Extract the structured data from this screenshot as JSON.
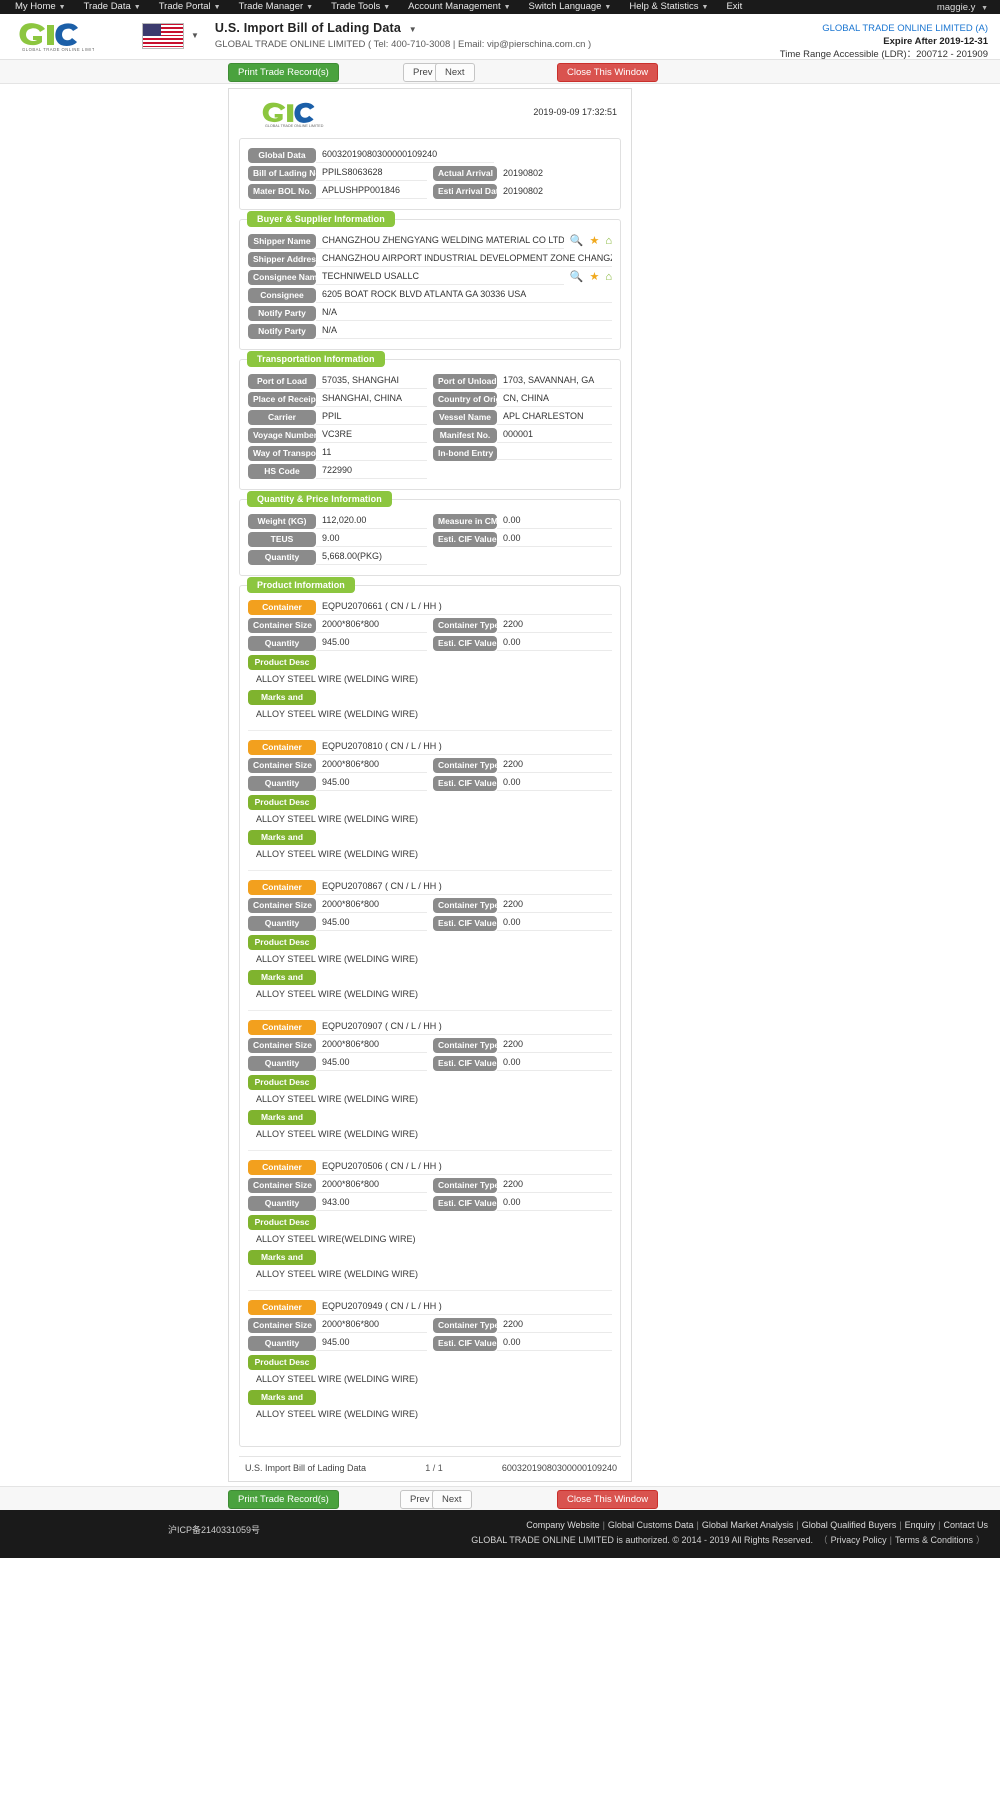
{
  "topnav": {
    "items": [
      {
        "label": "My Home",
        "caret": true
      },
      {
        "label": "Trade Data",
        "caret": true
      },
      {
        "label": "Trade Portal",
        "caret": true
      },
      {
        "label": "Trade Manager",
        "caret": true
      },
      {
        "label": "Trade Tools",
        "caret": true
      },
      {
        "label": "Account Management",
        "caret": true
      },
      {
        "label": "Switch Language",
        "caret": true
      },
      {
        "label": "Help & Statistics",
        "caret": true
      },
      {
        "label": "Exit",
        "caret": false
      }
    ],
    "user": "maggie.y"
  },
  "header": {
    "logo_text": "GLOBAL TRADE ONLINE LIMITED",
    "flag_icon": "us-flag-icon",
    "title": "U.S. Import Bill of Lading Data",
    "subtitle": "GLOBAL TRADE ONLINE LIMITED ( Tel: 400-710-3008 | Email: vip@pierschina.com.cn )",
    "account": "GLOBAL TRADE ONLINE LIMITED (A)",
    "expire": "Expire After 2019-12-31",
    "time_range": "Time Range Accessible (LDR)：200712 - 201909"
  },
  "toolbar": {
    "print_label": "Print Trade Record(s)",
    "prev_label": "Prev",
    "next_label": "Next",
    "close_label": "Close This Window"
  },
  "sheet": {
    "timestamp": "2019-09-09 17:32:51",
    "basic": {
      "global_data_label": "Global Data",
      "global_data_value": "60032019080300000109240",
      "bol_label": "Bill of Lading No.",
      "bol_value": "PPILS8063628",
      "actual_arrival_label": "Actual Arrival",
      "actual_arrival_value": "20190802",
      "master_bol_label": "Mater BOL No.",
      "master_bol_value": "APLUSHPP001846",
      "esti_arrival_label": "Esti Arrival Date",
      "esti_arrival_value": "20190802"
    },
    "buyer_supplier": {
      "legend": "Buyer & Supplier Information",
      "rows": [
        {
          "label": "Shipper Name",
          "value": "CHANGZHOU ZHENGYANG WELDING MATERIAL CO LTD",
          "icons": true
        },
        {
          "label": "Shipper Address",
          "value": "CHANGZHOU AIRPORT INDUSTRIAL DEVELOPMENT ZONE CHANGZHO",
          "icons": false
        },
        {
          "label": "Consignee Name",
          "value": "TECHNIWELD USALLC",
          "icons": true
        },
        {
          "label": "Consignee",
          "value": "6205 BOAT ROCK BLVD ATLANTA GA 30336 USA",
          "icons": false
        },
        {
          "label": "Notify Party",
          "value": "N/A",
          "icons": false
        },
        {
          "label": "Notify Party",
          "value": "N/A",
          "icons": false
        }
      ]
    },
    "transportation": {
      "legend": "Transportation Information",
      "rows": [
        {
          "l1": "Port of Load",
          "v1": "57035, SHANGHAI",
          "l2": "Port of Unload",
          "v2": "1703, SAVANNAH, GA"
        },
        {
          "l1": "Place of Receipt",
          "v1": "SHANGHAI, CHINA",
          "l2": "Country of Origin",
          "v2": "CN, CHINA"
        },
        {
          "l1": "Carrier",
          "v1": "PPIL",
          "l2": "Vessel Name",
          "v2": "APL CHARLESTON"
        },
        {
          "l1": "Voyage Number",
          "v1": "VC3RE",
          "l2": "Manifest No.",
          "v2": "000001"
        },
        {
          "l1": "Way of Transport",
          "v1": "11",
          "l2": "In-bond Entry",
          "v2": ""
        }
      ],
      "hs_label": "HS Code",
      "hs_value": "722990"
    },
    "quantity_price": {
      "legend": "Quantity & Price Information",
      "rows": [
        {
          "l1": "Weight (KG)",
          "v1": "112,020.00",
          "l2": "Measure in CM",
          "v2": "0.00"
        },
        {
          "l1": "TEUS",
          "v1": "9.00",
          "l2": "Esti. CIF Value",
          "v2": "0.00"
        }
      ],
      "qty_label": "Quantity",
      "qty_value": "5,668.00(PKG)"
    },
    "product": {
      "legend": "Product Information",
      "labels": {
        "container": "Container",
        "container_size": "Container Size",
        "container_type": "Container Type",
        "quantity": "Quantity",
        "cif": "Esti. CIF Value",
        "product_desc": "Product Desc",
        "marks": "Marks and"
      },
      "items": [
        {
          "container": "EQPU2070661 ( CN / L / HH )",
          "size": "2000*806*800",
          "type": "2200",
          "quantity": "945.00",
          "cif": "0.00",
          "desc": "ALLOY STEEL WIRE (WELDING WIRE)",
          "marks": "ALLOY STEEL WIRE (WELDING WIRE)"
        },
        {
          "container": "EQPU2070810 ( CN / L / HH )",
          "size": "2000*806*800",
          "type": "2200",
          "quantity": "945.00",
          "cif": "0.00",
          "desc": "ALLOY STEEL WIRE (WELDING WIRE)",
          "marks": "ALLOY STEEL WIRE (WELDING WIRE)"
        },
        {
          "container": "EQPU2070867 ( CN / L / HH )",
          "size": "2000*806*800",
          "type": "2200",
          "quantity": "945.00",
          "cif": "0.00",
          "desc": "ALLOY STEEL WIRE (WELDING WIRE)",
          "marks": "ALLOY STEEL WIRE (WELDING WIRE)"
        },
        {
          "container": "EQPU2070907 ( CN / L / HH )",
          "size": "2000*806*800",
          "type": "2200",
          "quantity": "945.00",
          "cif": "0.00",
          "desc": "ALLOY STEEL WIRE (WELDING WIRE)",
          "marks": "ALLOY STEEL WIRE (WELDING WIRE)"
        },
        {
          "container": "EQPU2070506 ( CN / L / HH )",
          "size": "2000*806*800",
          "type": "2200",
          "quantity": "943.00",
          "cif": "0.00",
          "desc": "ALLOY STEEL WIRE(WELDING WIRE)",
          "marks": "ALLOY STEEL WIRE (WELDING WIRE)"
        },
        {
          "container": "EQPU2070949 ( CN / L / HH )",
          "size": "2000*806*800",
          "type": "2200",
          "quantity": "945.00",
          "cif": "0.00",
          "desc": "ALLOY STEEL WIRE (WELDING WIRE)",
          "marks": "ALLOY STEEL WIRE (WELDING WIRE)"
        }
      ]
    },
    "footer": {
      "left": "U.S. Import Bill of Lading Data",
      "mid": "1 / 1",
      "right": "60032019080300000109240"
    }
  },
  "page_footer": {
    "links": [
      "Company Website",
      "Global Customs Data",
      "Global Market Analysis",
      "Global Qualified Buyers",
      "Enquiry",
      "Contact Us"
    ],
    "copy_prefix": "GLOBAL TRADE ONLINE LIMITED is authorized. © 2014 - 2019 All Rights Reserved.",
    "copy_links": [
      "Privacy Policy",
      "Terms & Conditions"
    ],
    "icp": "沪ICP备2140331059号"
  },
  "colors": {
    "green": "#8cc63f",
    "orange": "#f2a01e",
    "grey_label": "#8b8b8b",
    "red": "#d9534f",
    "blue_link": "#1b76d1"
  }
}
